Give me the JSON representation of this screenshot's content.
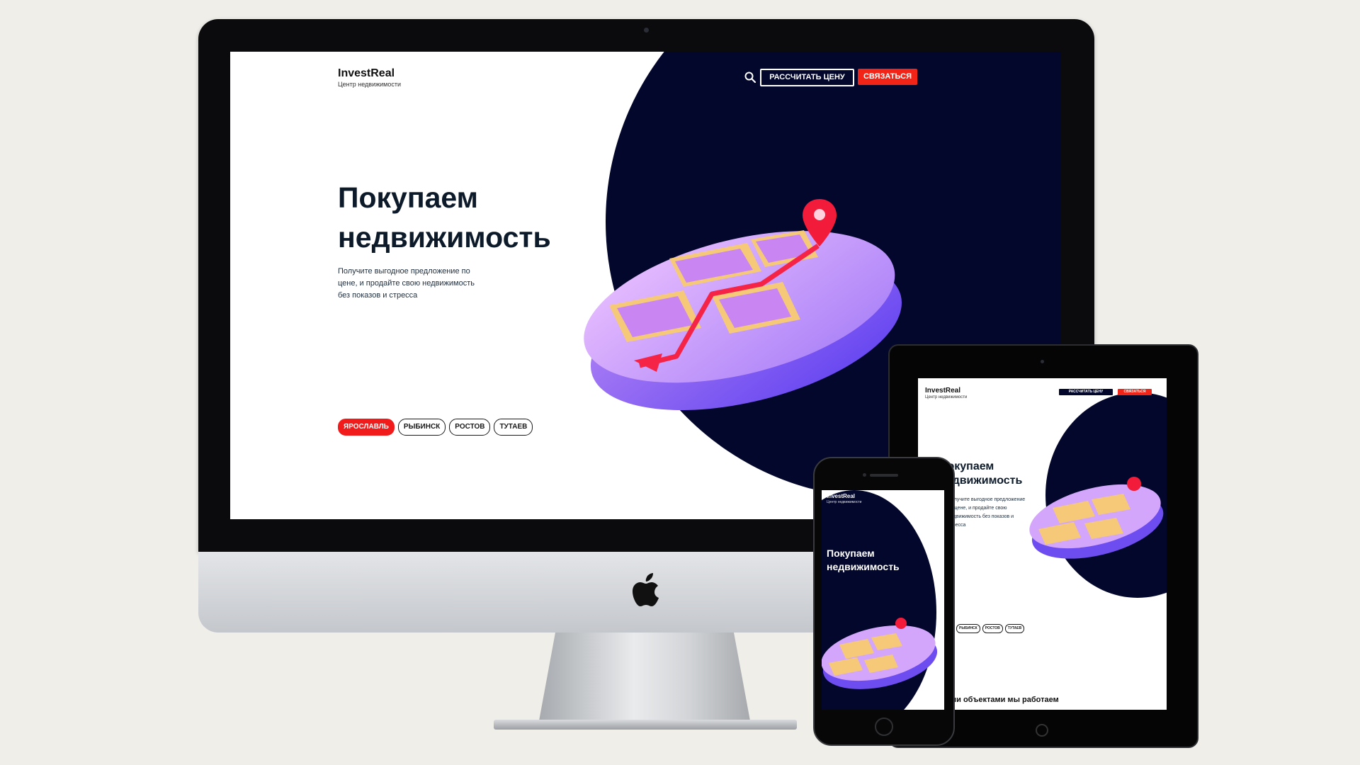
{
  "brand": {
    "name": "InvestReal",
    "tagline": "Центр недвижимости"
  },
  "header": {
    "search_icon": "search-icon",
    "calc_label": "РАССЧИТАТЬ ЦЕНУ",
    "contact_label": "СВЯЗАТЬСЯ"
  },
  "hero": {
    "title": "Покупаем недвижимость",
    "subtitle": "Получите выгодное предложение по цене, и продайте свою недвижимость без показов и стресса"
  },
  "cities": [
    {
      "label": "ЯРОСЛАВЛЬ",
      "active": true
    },
    {
      "label": "РЫБИНСК",
      "active": false
    },
    {
      "label": "РОСТОВ",
      "active": false
    },
    {
      "label": "ТУТАЕВ",
      "active": false
    }
  ],
  "tablet": {
    "title_visible": "Покупаем недвижимость",
    "subtitle_visible": "ыгодное предложение по цене, и продайте свою недвижимость без показов и",
    "section_title_fragment": "ми объектами мы работаем"
  },
  "colors": {
    "navy": "#02072b",
    "accent_red": "#f22417",
    "page_bg": "#efeee9"
  }
}
